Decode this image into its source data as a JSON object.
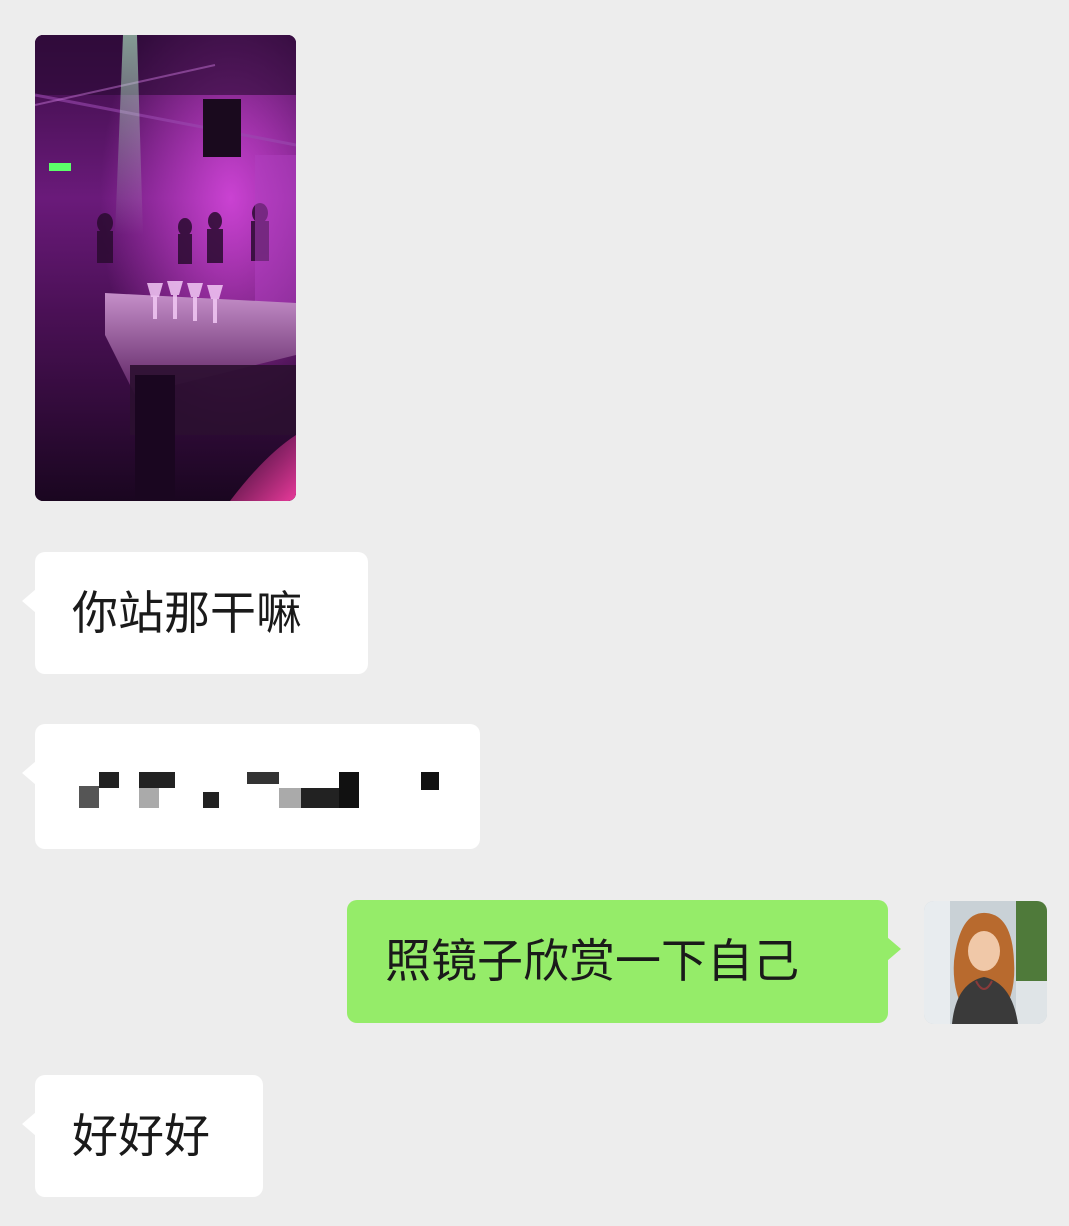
{
  "chat": {
    "messages": [
      {
        "id": "m0",
        "direction": "incoming",
        "type": "image",
        "image_description": "nightclub"
      },
      {
        "id": "m1",
        "direction": "incoming",
        "type": "text",
        "text": "你站那干嘛"
      },
      {
        "id": "m2",
        "direction": "incoming",
        "type": "text-redacted",
        "text": ""
      },
      {
        "id": "m3",
        "direction": "outgoing",
        "type": "text",
        "text": "照镜子欣赏一下自己"
      },
      {
        "id": "m4",
        "direction": "incoming",
        "type": "text",
        "text": "好好好"
      }
    ]
  },
  "colors": {
    "background": "#ededed",
    "incoming_bubble": "#ffffff",
    "outgoing_bubble": "#95ec69",
    "text": "#1a1a1a"
  }
}
